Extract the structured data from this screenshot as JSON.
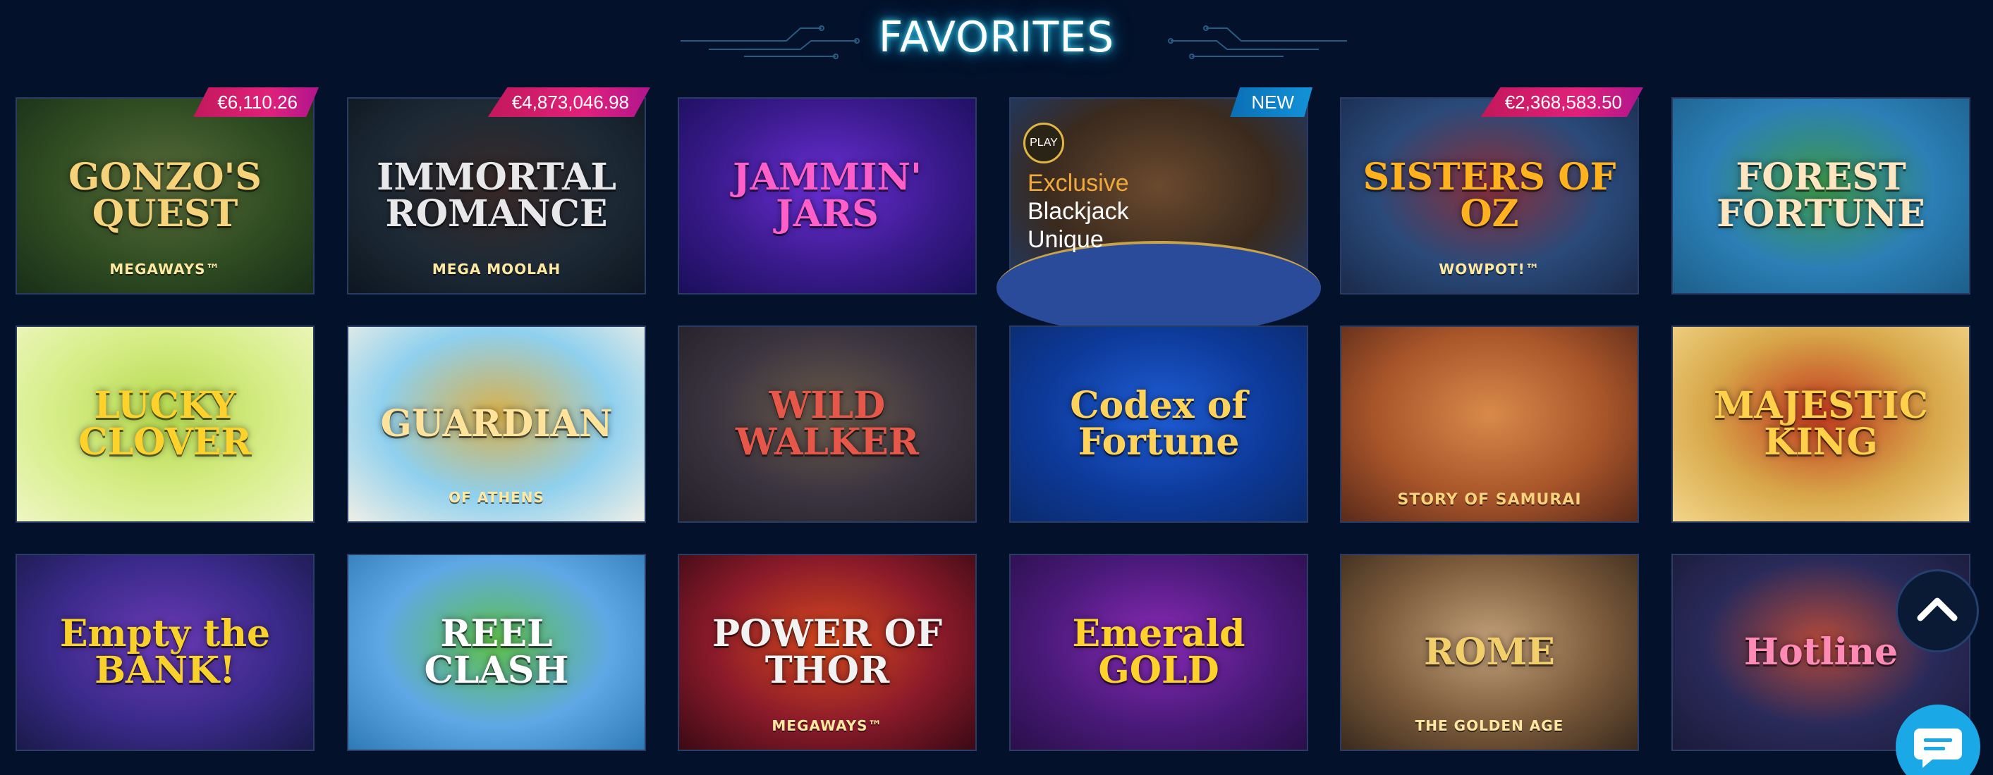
{
  "section": {
    "title": "FAVORITES"
  },
  "games": [
    {
      "title": "GONZO'S\nQUEST",
      "subtitle": "MEGAWAYS™",
      "badge": "€6,110.26",
      "badge_type": "jackpot",
      "colors": [
        "#2f4d22",
        "#5a6b3a",
        "#1a2e18"
      ],
      "title_color": "#f6d27a"
    },
    {
      "title": "IMMORTAL ROMANCE",
      "subtitle": "MEGA MOOLAH",
      "badge": "€4,873,046.98",
      "badge_type": "jackpot",
      "colors": [
        "#1d2a36",
        "#3b2a28",
        "#0d1620"
      ],
      "title_color": "#e8e8ea"
    },
    {
      "title": "JAMMIN'\nJARS",
      "subtitle": "",
      "badge": "",
      "badge_type": "",
      "colors": [
        "#3a1a8c",
        "#6b2fd6",
        "#1a0f5a"
      ],
      "title_color": "#ff5fc8"
    },
    {
      "title": "",
      "subtitle": "",
      "badge": "NEW",
      "badge_type": "new",
      "live": {
        "chip": "PLAY",
        "lines": [
          "Exclusive",
          "Blackjack",
          "Unique"
        ]
      },
      "colors": [
        "#3a2a1e",
        "#6b4a2e",
        "#1d3a6b"
      ],
      "title_color": "#ffffff"
    },
    {
      "title": "SISTERS OF OZ",
      "subtitle": "WOWPOT!™",
      "badge": "€2,368,583.50",
      "badge_type": "jackpot",
      "colors": [
        "#2a4a7a",
        "#8a2f3a",
        "#1a2a4a"
      ],
      "title_color": "#ffb21e"
    },
    {
      "title": "FOREST\nFORTUNE",
      "subtitle": "",
      "badge": "",
      "badge_type": "",
      "colors": [
        "#2b7fb6",
        "#3f9a4a",
        "#1d5f8a"
      ],
      "title_color": "#ffe6c0"
    },
    {
      "title": "LUCKY\nCLOVER",
      "subtitle": "",
      "badge": "",
      "badge_type": "",
      "colors": [
        "#d7ee8a",
        "#b6d94e",
        "#eef6c2"
      ],
      "title_color": "#ffd22b"
    },
    {
      "title": "GUARDIAN",
      "subtitle": "OF ATHENS",
      "badge": "",
      "badge_type": "",
      "colors": [
        "#8fd0ee",
        "#d9b04a",
        "#f0efe6"
      ],
      "title_color": "#ffe39a"
    },
    {
      "title": "WILD\nWALKER",
      "subtitle": "",
      "badge": "",
      "badge_type": "",
      "colors": [
        "#3a3440",
        "#6b5a4a",
        "#241e28"
      ],
      "title_color": "#e6574a"
    },
    {
      "title": "Codex of Fortune",
      "subtitle": "",
      "badge": "",
      "badge_type": "",
      "colors": [
        "#0d3a9a",
        "#1f5ed6",
        "#0a2a6b"
      ],
      "title_color": "#ffd25a"
    },
    {
      "title": "",
      "subtitle": "STORY OF SAMURAI",
      "badge": "",
      "badge_type": "",
      "colors": [
        "#a8552a",
        "#d88a4a",
        "#5a2a1a"
      ],
      "title_color": "#ffffff"
    },
    {
      "title": "MAJESTIC\nKING",
      "subtitle": "",
      "badge": "",
      "badge_type": "",
      "colors": [
        "#d8a84a",
        "#c2381e",
        "#f2d68a"
      ],
      "title_color": "#ffd04a"
    },
    {
      "title": "Empty the BANK!",
      "subtitle": "",
      "badge": "",
      "badge_type": "",
      "colors": [
        "#3a2a8a",
        "#6b3ab6",
        "#1a1a4a"
      ],
      "title_color": "#f8d22a"
    },
    {
      "title": "REEL\nCLASH",
      "subtitle": "",
      "badge": "",
      "badge_type": "",
      "colors": [
        "#5fa8e6",
        "#5fc24a",
        "#2e7ab6"
      ],
      "title_color": "#ffffff"
    },
    {
      "title": "POWER OF\nTHOR",
      "subtitle": "MEGAWAYS™",
      "badge": "",
      "badge_type": "",
      "colors": [
        "#8a1a2a",
        "#d84a1e",
        "#3a0a14"
      ],
      "title_color": "#f2f2f2"
    },
    {
      "title": "Emerald\nGOLD",
      "subtitle": "",
      "badge": "",
      "badge_type": "",
      "colors": [
        "#4a1a7a",
        "#8a2ab6",
        "#2a0f4a"
      ],
      "title_color": "#ffd22b"
    },
    {
      "title": "ROME",
      "subtitle": "THE GOLDEN AGE",
      "badge": "",
      "badge_type": "",
      "colors": [
        "#7a5a3a",
        "#c2a07a",
        "#3a2a1e"
      ],
      "title_color": "#f2cf6a"
    },
    {
      "title": "Hotline",
      "subtitle": "",
      "badge": "",
      "badge_type": "",
      "colors": [
        "#2a2a5a",
        "#b64a3a",
        "#1a1a3a"
      ],
      "title_color": "#ff8ab6"
    }
  ],
  "controls": {
    "scroll_top_icon": "chevron-up-icon",
    "chat_icon": "chat-bubble-icon"
  },
  "theme": {
    "background": "#03112a",
    "title_glow": "#3fd6f0",
    "tile_border": "#2a3c66",
    "badge_jackpot": "#e0217a",
    "badge_new": "#1392d8",
    "chat_button": "#1aa8e6"
  }
}
